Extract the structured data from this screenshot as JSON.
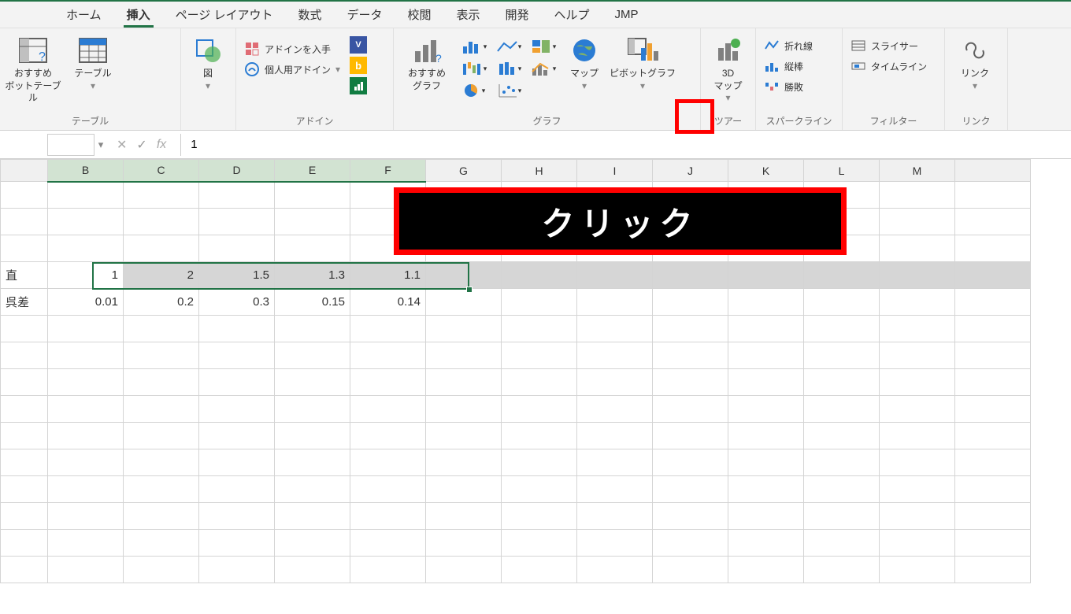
{
  "tabs": {
    "home": "ホーム",
    "insert": "挿入",
    "pagelayout": "ページ レイアウト",
    "formulas": "数式",
    "data": "データ",
    "review": "校閲",
    "view": "表示",
    "developer": "開発",
    "help": "ヘルプ",
    "jmp": "JMP"
  },
  "ribbon": {
    "tables_group": "テーブル",
    "pivot": "おすすめ\nボットテーブル",
    "table": "テーブル",
    "illustrations_group": "",
    "illustrations": "図",
    "addins_group": "アドイン",
    "get_addins": "アドインを入手",
    "my_addins": "個人用アドイン",
    "charts_group": "グラフ",
    "rec_charts": "おすすめ\nグラフ",
    "maps": "マップ",
    "pivotchart": "ピボットグラフ",
    "tours_group": "ツアー",
    "map3d": "3D\nマップ",
    "sparklines_group": "スパークライン",
    "spark_line": "折れ線",
    "spark_col": "縦棒",
    "spark_wl": "勝敗",
    "filters_group": "フィルター",
    "slicer": "スライサー",
    "timeline": "タイムライン",
    "links_group": "リンク",
    "link": "リンク"
  },
  "formula_bar": {
    "value": "1"
  },
  "columns": [
    "B",
    "C",
    "D",
    "E",
    "F",
    "G",
    "H",
    "I",
    "J",
    "K",
    "L",
    "M"
  ],
  "visible_colA_header": "",
  "sheet": {
    "rowA_labels": [
      "直",
      "呉差"
    ],
    "row_values": {
      "r4": [
        "1",
        "2",
        "1.5",
        "1.3",
        "1.1"
      ],
      "r5": [
        "0.01",
        "0.2",
        "0.3",
        "0.15",
        "0.14"
      ]
    }
  },
  "callout": "クリック",
  "colors": {
    "accent": "#217346",
    "highlight": "#ff0000"
  }
}
